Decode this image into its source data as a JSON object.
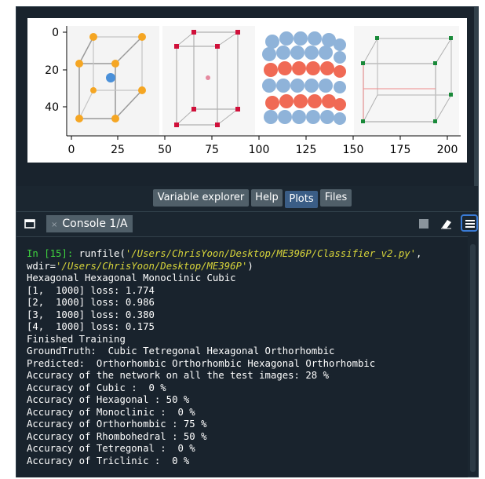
{
  "plot": {
    "y_ticks": [
      "0",
      "20",
      "40"
    ],
    "x_ticks": [
      "0",
      "25",
      "50",
      "75",
      "100",
      "125",
      "150",
      "175",
      "200"
    ]
  },
  "pane_tabs": [
    {
      "label": "Variable explorer",
      "active": false
    },
    {
      "label": "Help",
      "active": false
    },
    {
      "label": "Plots",
      "active": true
    },
    {
      "label": "Files",
      "active": false
    }
  ],
  "console_tab": {
    "label": "Console 1/A",
    "close": "×"
  },
  "console": {
    "prompt": "In [15]:",
    "cmd": " runfile(",
    "path1": "'/Users/ChrisYoon/Desktop/ME396P/Classifier_v2.py'",
    "comma": ",",
    "wdir_label": "wdir=",
    "path2": "'/Users/ChrisYoon/Desktop/ME396P'",
    "close_paren": ")",
    "output_lines": [
      "Hexagonal Hexagonal Monoclinic Cubic",
      "[1,  1000] loss: 1.774",
      "[2,  1000] loss: 0.986",
      "[3,  1000] loss: 0.380",
      "[4,  1000] loss: 0.175",
      "Finished Training",
      "GroundTruth:  Cubic Tetregonal Hexagonal Orthorhombic",
      "Predicted:  Orthorhombic Orthorhombic Hexagonal Orthorhombic",
      "Accuracy of the network on all the test images: 28 %",
      "Accuracy of Cubic :  0 %",
      "Accuracy of Hexagonal : 50 %",
      "Accuracy of Monoclinic :  0 %",
      "Accuracy of Orthorhombic : 75 %",
      "Accuracy of Rhombohedral : 50 %",
      "Accuracy of Tetregonal :  0 %",
      "Accuracy of Triclinic :  0 %"
    ]
  },
  "colors": {
    "background": "#19232d",
    "prompt": "#3fd43f",
    "path": "#d7d43a",
    "active_tab": "#3a5d86"
  }
}
